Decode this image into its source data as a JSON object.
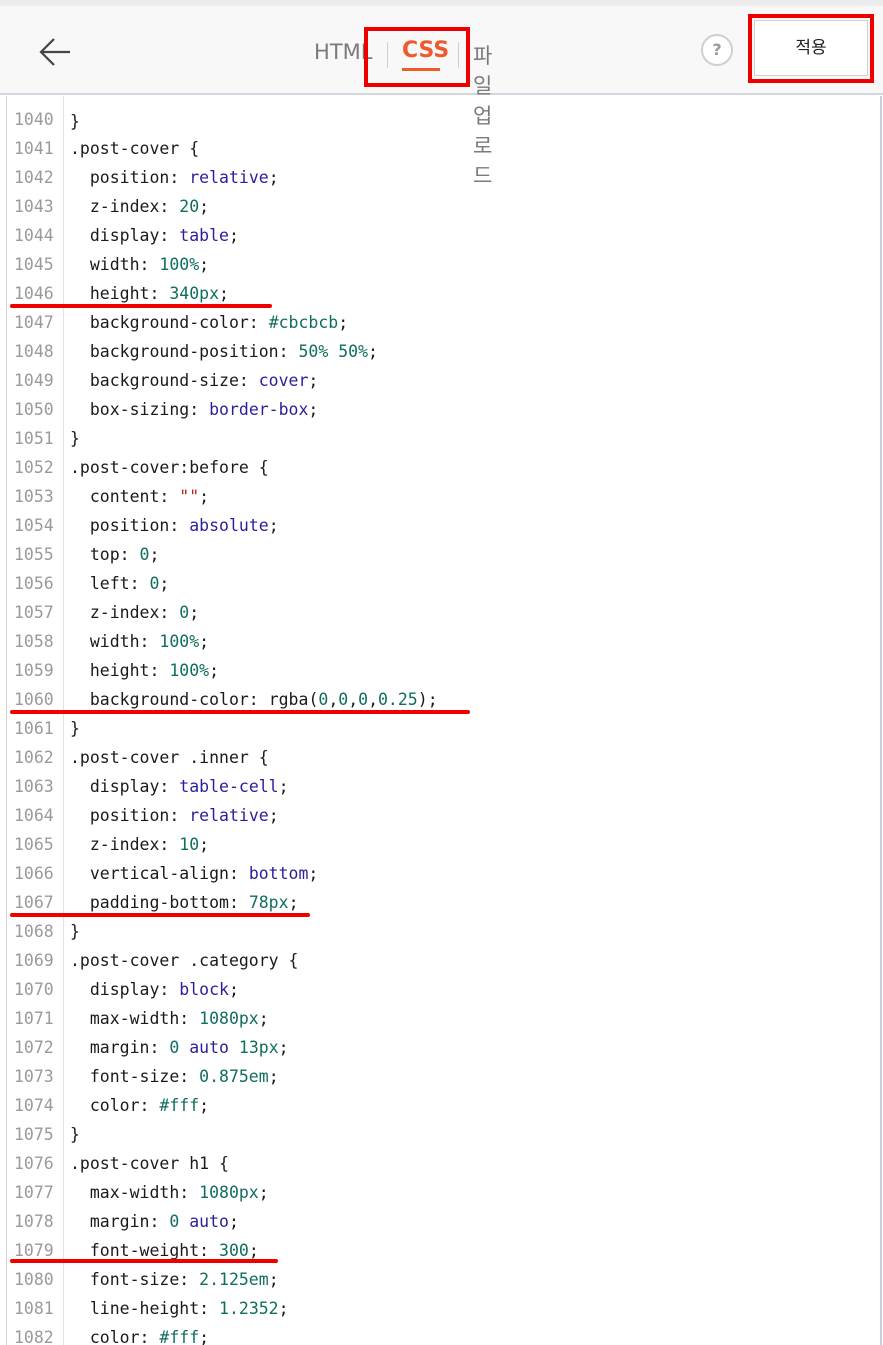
{
  "toolbar": {
    "tabs": {
      "html": "HTML",
      "css": "CSS",
      "upload": "파일업로드"
    },
    "help": "?",
    "apply": "적용",
    "accent_color": "#ef5a2c",
    "highlight_color": "#ee0000"
  },
  "editor": {
    "lines": [
      {
        "n": "1040",
        "code": ""
      },
      {
        "n": "1041",
        "code": ".post-cover {"
      },
      {
        "n": "1042",
        "code": "  position: relative;"
      },
      {
        "n": "1043",
        "code": "  z-index: 20;"
      },
      {
        "n": "1044",
        "code": "  display: table;"
      },
      {
        "n": "1045",
        "code": "  width: 100%;"
      },
      {
        "n": "1046",
        "code": "  height: 340px;"
      },
      {
        "n": "1047",
        "code": "  background-color: #cbcbcb;"
      },
      {
        "n": "1048",
        "code": "  background-position: 50% 50%;"
      },
      {
        "n": "1049",
        "code": "  background-size: cover;"
      },
      {
        "n": "1050",
        "code": "  box-sizing: border-box;"
      },
      {
        "n": "1051",
        "code": "}"
      },
      {
        "n": "1052",
        "code": ".post-cover:before {"
      },
      {
        "n": "1053",
        "code": "  content: \"\";"
      },
      {
        "n": "1054",
        "code": "  position: absolute;"
      },
      {
        "n": "1055",
        "code": "  top: 0;"
      },
      {
        "n": "1056",
        "code": "  left: 0;"
      },
      {
        "n": "1057",
        "code": "  z-index: 0;"
      },
      {
        "n": "1058",
        "code": "  width: 100%;"
      },
      {
        "n": "1059",
        "code": "  height: 100%;"
      },
      {
        "n": "1060",
        "code": "  background-color: rgba(0,0,0,0.25);"
      },
      {
        "n": "1061",
        "code": "}"
      },
      {
        "n": "1062",
        "code": ".post-cover .inner {"
      },
      {
        "n": "1063",
        "code": "  display: table-cell;"
      },
      {
        "n": "1064",
        "code": "  position: relative;"
      },
      {
        "n": "1065",
        "code": "  z-index: 10;"
      },
      {
        "n": "1066",
        "code": "  vertical-align: bottom;"
      },
      {
        "n": "1067",
        "code": "  padding-bottom: 78px;"
      },
      {
        "n": "1068",
        "code": "}"
      },
      {
        "n": "1069",
        "code": ".post-cover .category {"
      },
      {
        "n": "1070",
        "code": "  display: block;"
      },
      {
        "n": "1071",
        "code": "  max-width: 1080px;"
      },
      {
        "n": "1072",
        "code": "  margin: 0 auto 13px;"
      },
      {
        "n": "1073",
        "code": "  font-size: 0.875em;"
      },
      {
        "n": "1074",
        "code": "  color: #fff;"
      },
      {
        "n": "1075",
        "code": "}"
      },
      {
        "n": "1076",
        "code": ".post-cover h1 {"
      },
      {
        "n": "1077",
        "code": "  max-width: 1080px;"
      },
      {
        "n": "1078",
        "code": "  margin: 0 auto;"
      },
      {
        "n": "1079",
        "code": "  font-weight: 300;"
      },
      {
        "n": "1080",
        "code": "  font-size: 2.125em;"
      },
      {
        "n": "1081",
        "code": "  line-height: 1.2352;"
      },
      {
        "n": "1082",
        "code": "  color: #fff;"
      }
    ],
    "highlighted_lines": [
      "1046",
      "1060",
      "1067",
      "1079"
    ]
  }
}
